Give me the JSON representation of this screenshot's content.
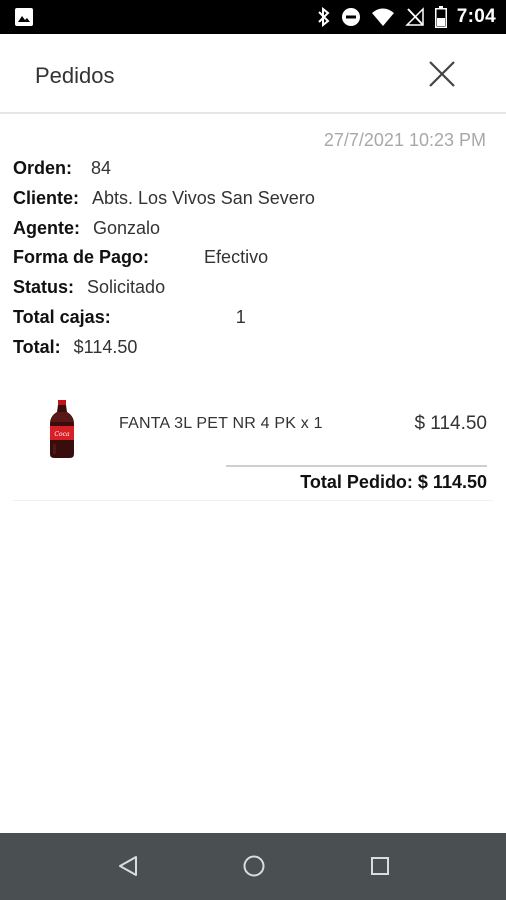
{
  "status_bar": {
    "time": "7:04",
    "icons": [
      "image-icon",
      "bluetooth-icon",
      "do-not-disturb-icon",
      "wifi-icon",
      "no-signal-icon",
      "battery-icon"
    ]
  },
  "app_bar": {
    "title": "Pedidos",
    "close_icon": "close-icon"
  },
  "order": {
    "date": "27/7/2021 10:23 PM",
    "fields": [
      {
        "label": "Orden:",
        "value": "84"
      },
      {
        "label": "Cliente:",
        "value": "Abts. Los Vivos San Severo"
      },
      {
        "label": "Agente:",
        "value": "Gonzalo"
      },
      {
        "label": "Forma de Pago:",
        "value": "Efectivo"
      },
      {
        "label": "Status:",
        "value": "Solicitado"
      },
      {
        "label": "Total cajas:",
        "value": "1"
      },
      {
        "label": "Total:",
        "value": "$114.50"
      }
    ]
  },
  "items": [
    {
      "image": "soda-bottle-image",
      "description": "FANTA 3L PET NR 4 PK x 1",
      "price": "$ 114.50"
    }
  ],
  "total_pedido": "Total Pedido: $ 114.50",
  "nav_bar": {
    "icons": [
      "back-icon",
      "home-icon",
      "recents-icon"
    ]
  },
  "colors": {
    "status_bar_bg": "#000000",
    "nav_bar_bg": "#4a4f51",
    "date_text": "#a8a8a8"
  }
}
